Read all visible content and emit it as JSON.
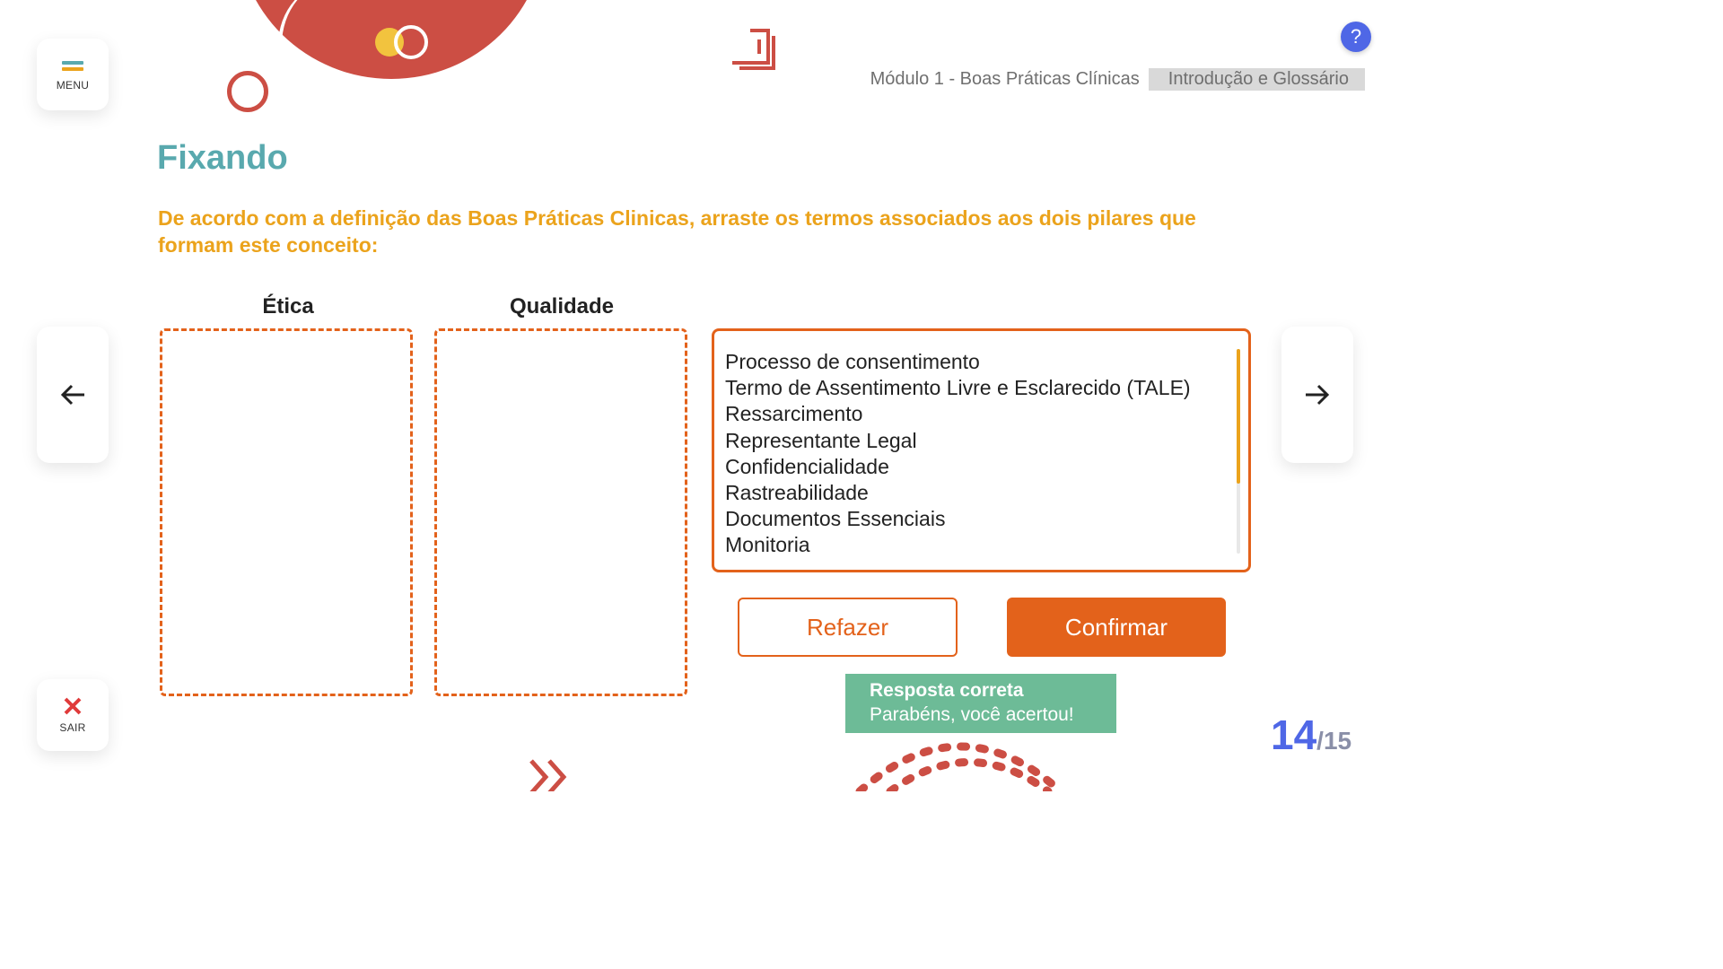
{
  "menu": {
    "label": "MENU"
  },
  "exit": {
    "label": "SAIR"
  },
  "breadcrumb": {
    "module": "Módulo 1 - Boas Práticas Clínicas",
    "section": "Introdução e Glossário"
  },
  "help": {
    "label": "?"
  },
  "activity": {
    "title": "Fixando",
    "instruction": "De acordo com a definição das Boas Práticas Clinicas, arraste os termos associados aos dois pilares que formam este conceito:",
    "columns": [
      {
        "title": "Ética"
      },
      {
        "title": "Qualidade"
      }
    ],
    "terms": [
      "Processo de consentimento",
      "Termo de Assentimento Livre e Esclarecido (TALE)",
      "Ressarcimento",
      "Representante Legal",
      "Confidencialidade",
      "Rastreabilidade",
      "Documentos Essenciais",
      "Monitoria"
    ],
    "redo_label": "Refazer",
    "confirm_label": "Confirmar"
  },
  "feedback": {
    "title": "Resposta correta",
    "message": "Parabéns, você acertou!"
  },
  "pagination": {
    "current": "14",
    "total": "/15"
  },
  "nav": {
    "prev_icon": "arrow-left-icon",
    "next_icon": "arrow-right-icon"
  },
  "colors": {
    "accent_orange": "#e3621b",
    "title_teal": "#59a9ae",
    "instruction_yellow": "#eba31c",
    "success_green": "#6dbb97",
    "page_blue": "#4f67e6",
    "deco_red": "#cc4e44"
  }
}
